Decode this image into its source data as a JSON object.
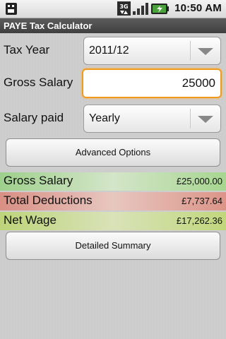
{
  "status_bar": {
    "time": "10:50 AM",
    "network": "3G",
    "icons": [
      "usb-debug-icon",
      "3g-icon",
      "signal-icon",
      "battery-charging-icon"
    ]
  },
  "app": {
    "title": "PAYE Tax Calculator"
  },
  "form": {
    "tax_year_label": "Tax Year",
    "tax_year_value": "2011/12",
    "gross_salary_label": "Gross Salary",
    "gross_salary_value": "25000",
    "salary_paid_label": "Salary paid",
    "salary_paid_value": "Yearly",
    "advanced_options_label": "Advanced Options"
  },
  "results": [
    {
      "label": "Gross Salary",
      "amount": "£25,000.00",
      "color": "#9ed08c"
    },
    {
      "label": "Total Deductions",
      "amount": "£7,737.64",
      "color": "#d98f84"
    },
    {
      "label": "Net Wage",
      "amount": "£17,262.36",
      "color": "#bdd47a"
    }
  ],
  "detailed_summary_label": "Detailed Summary",
  "colors": {
    "focus_border": "#f39a1e",
    "title_bar": "#4a4a4a"
  }
}
